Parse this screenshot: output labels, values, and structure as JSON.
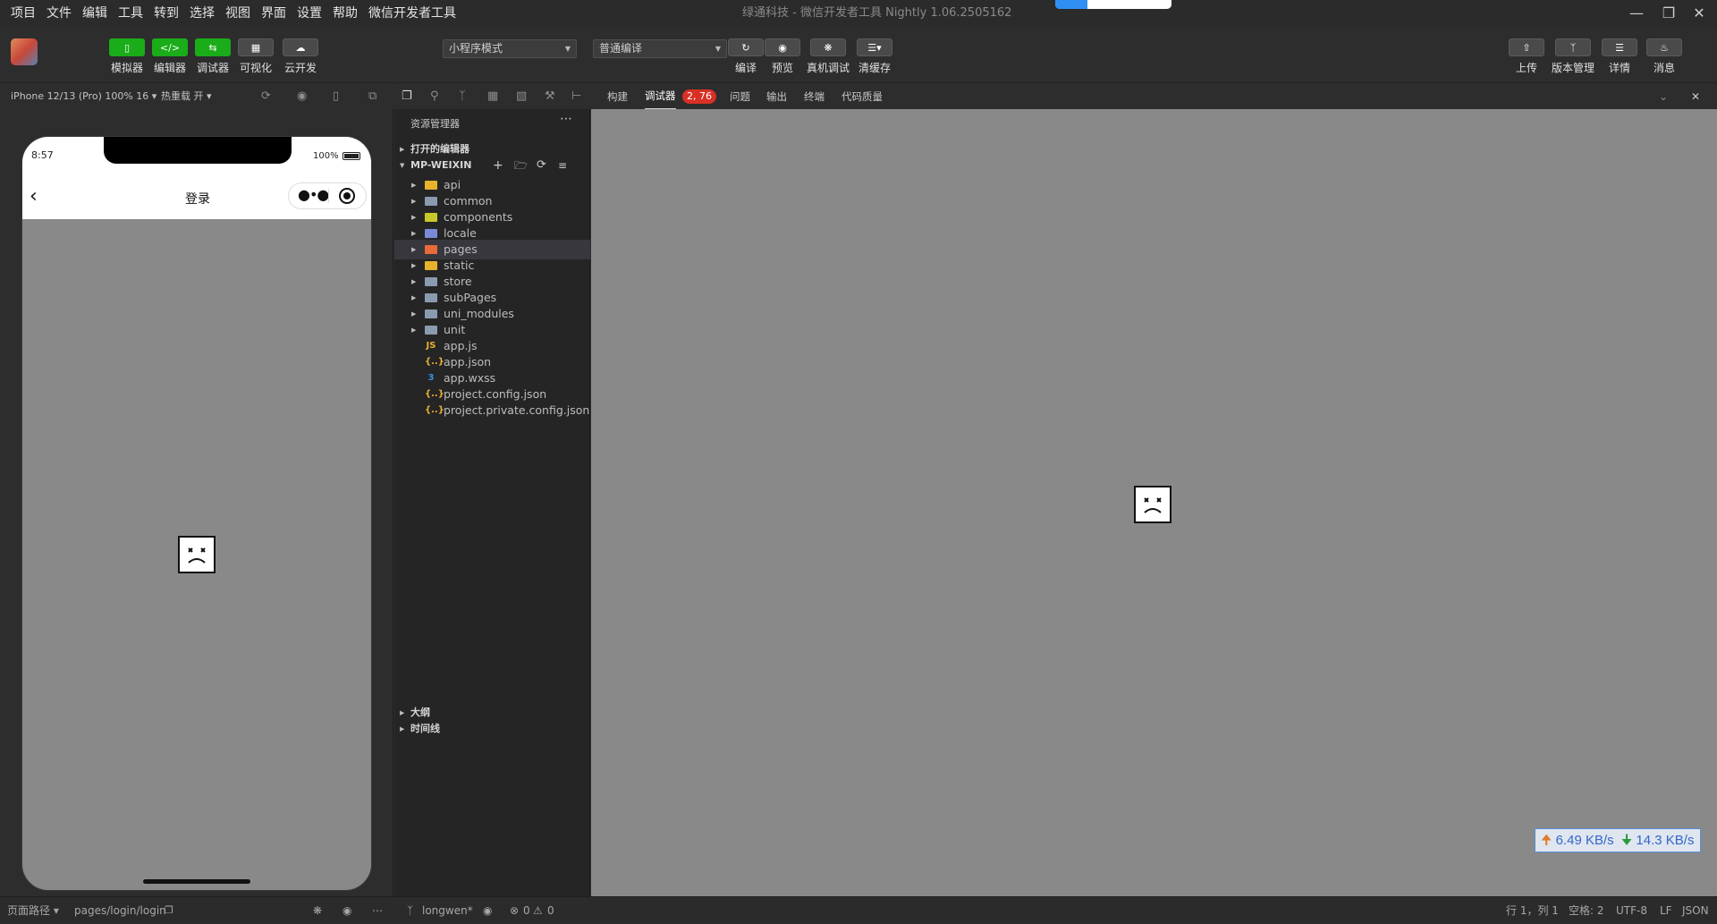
{
  "menubar": {
    "items": [
      "项目",
      "文件",
      "编辑",
      "工具",
      "转到",
      "选择",
      "视图",
      "界面",
      "设置",
      "帮助",
      "微信开发者工具"
    ],
    "title": "绿通科技 - 微信开发者工具 Nightly 1.06.2505162"
  },
  "toolbar": {
    "left": [
      {
        "label": "模拟器",
        "icon": "phone-icon",
        "style": "green"
      },
      {
        "label": "编辑器",
        "icon": "code-icon",
        "style": "green"
      },
      {
        "label": "调试器",
        "icon": "debug-arrows-icon",
        "style": "green"
      },
      {
        "label": "可视化",
        "icon": "layout-icon",
        "style": "gray"
      },
      {
        "label": "云开发",
        "icon": "cloud-icon",
        "style": "gray"
      }
    ],
    "mode_select": "小程序模式",
    "compile_select": "普通编译",
    "mid": [
      {
        "label": "编译",
        "icon": "refresh-icon"
      },
      {
        "label": "预览",
        "icon": "eye-icon"
      },
      {
        "label": "真机调试",
        "icon": "bug-icon"
      },
      {
        "label": "清缓存",
        "icon": "layers-icon"
      }
    ],
    "right": [
      {
        "label": "上传",
        "icon": "upload-icon"
      },
      {
        "label": "版本管理",
        "icon": "branch-icon"
      },
      {
        "label": "详情",
        "icon": "list-icon"
      },
      {
        "label": "消息",
        "icon": "bell-icon"
      }
    ]
  },
  "device_bar": {
    "device": "iPhone 12/13 (Pro) 100% 16 ▾",
    "hot_reload": "热重载 开 ▾"
  },
  "phone": {
    "time": "8:57",
    "battery": "100%",
    "nav_title": "登录"
  },
  "explorer": {
    "header": "资源管理器",
    "open_editors": "打开的编辑器",
    "project": "MP-WEIXIN",
    "folders": [
      {
        "name": "api",
        "color": "#e8b22c"
      },
      {
        "name": "common",
        "color": "#8a9bb0"
      },
      {
        "name": "components",
        "color": "#c8c82a"
      },
      {
        "name": "locale",
        "color": "#7a8ad8"
      },
      {
        "name": "pages",
        "color": "#e86a3a"
      },
      {
        "name": "static",
        "color": "#e8b22c"
      },
      {
        "name": "store",
        "color": "#8a9bb0"
      },
      {
        "name": "subPages",
        "color": "#8a9bb0"
      },
      {
        "name": "uni_modules",
        "color": "#8a9bb0"
      },
      {
        "name": "unit",
        "color": "#8a9bb0"
      }
    ],
    "files": [
      {
        "name": "app.js",
        "glyph": "JS",
        "color": "#e8b22c"
      },
      {
        "name": "app.json",
        "glyph": "{..}",
        "color": "#e8b22c"
      },
      {
        "name": "app.wxss",
        "glyph": "3",
        "color": "#3b8fe0"
      },
      {
        "name": "project.config.json",
        "glyph": "{..}",
        "color": "#e8b22c"
      },
      {
        "name": "project.private.config.json",
        "glyph": "{..}",
        "color": "#e8b22c"
      }
    ],
    "outline": "大纲",
    "timeline": "时间线"
  },
  "devtools": {
    "tabs": [
      "构建",
      "调试器",
      "问题",
      "输出",
      "终端",
      "代码质量"
    ],
    "badge": "2, 76"
  },
  "netspeed": {
    "up": "6.49 KB/s",
    "down": "14.3 KB/s"
  },
  "statusbar": {
    "page_path_label": "页面路径 ▾",
    "page_path": "pages/login/login",
    "branch": "longwen*",
    "errors": "0",
    "warnings": "0",
    "cursor": "行 1，列 1",
    "spaces": "空格: 2",
    "encoding": "UTF-8",
    "eol": "LF",
    "lang": "JSON"
  }
}
